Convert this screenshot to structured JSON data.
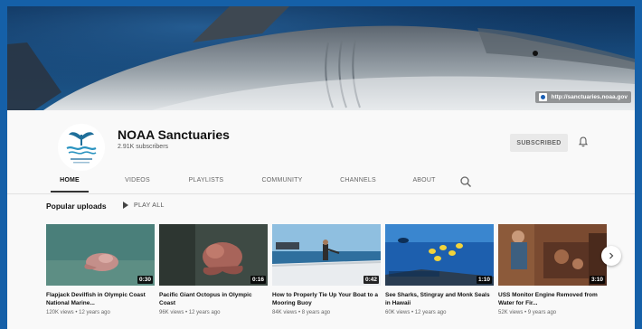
{
  "banner": {
    "link_text": "http://sanctuaries.noaa.gov",
    "image": "shark-banner"
  },
  "channel": {
    "name": "NOAA Sanctuaries",
    "subscribers": "2.91K subscribers",
    "subscribe_label": "SUBSCRIBED",
    "bell_icon": "bell-icon"
  },
  "tabs": [
    "HOME",
    "VIDEOS",
    "PLAYLISTS",
    "COMMUNITY",
    "CHANNELS",
    "ABOUT"
  ],
  "active_tab": "HOME",
  "section": {
    "title": "Popular uploads",
    "play_all_label": "PLAY ALL"
  },
  "videos": [
    {
      "title": "Flapjack Devilfish in Olympic Coast National Marine...",
      "meta": "120K views • 12 years ago",
      "duration": "0:30"
    },
    {
      "title": "Pacific Giant Octopus in Olympic Coast",
      "meta": "96K views • 12 years ago",
      "duration": "0:16"
    },
    {
      "title": "How to Properly Tie Up Your Boat to a Mooring Buoy",
      "meta": "84K views • 8 years ago",
      "duration": "0:42"
    },
    {
      "title": "See Sharks, Stingray and Monk Seals in Hawaii",
      "meta": "60K views • 12 years ago",
      "duration": "1:10"
    },
    {
      "title": "USS Monitor Engine Removed from Water for Fir...",
      "meta": "52K views • 9 years ago",
      "duration": "3:10"
    }
  ],
  "colors": {
    "page_background": "#1560a8",
    "frame_background": "#f9f9f9",
    "subscribed_button": "#e9e9e9"
  }
}
